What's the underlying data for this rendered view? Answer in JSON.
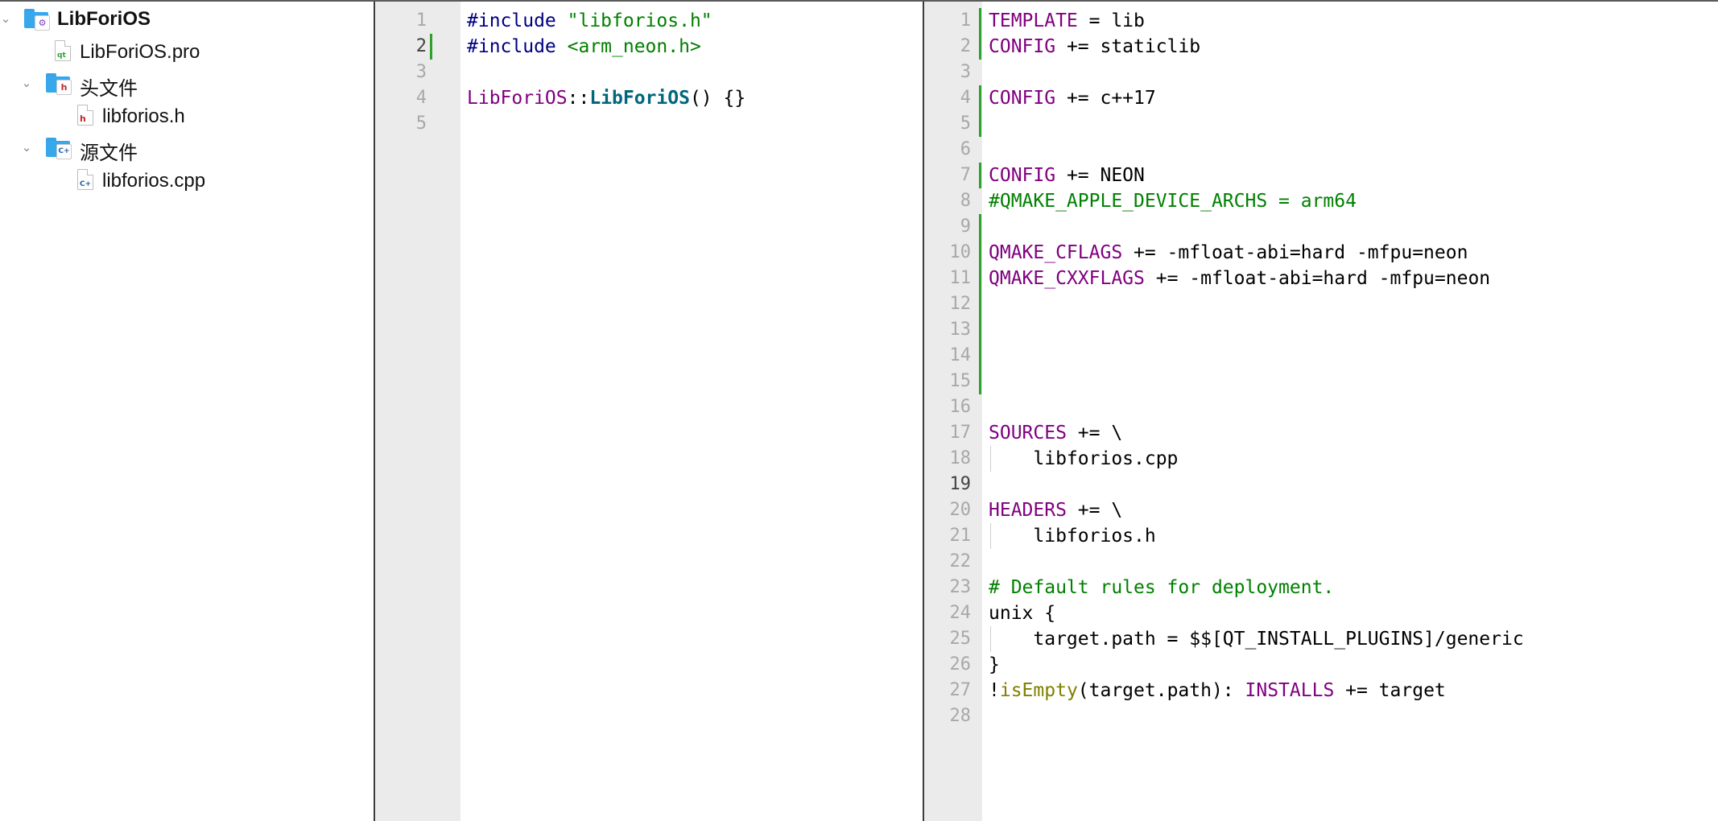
{
  "project_tree": {
    "root": {
      "label": "LibForiOS",
      "expanded": true
    },
    "items": [
      {
        "label": "LibForiOS.pro",
        "kind": "pro-file",
        "icon": "qt-pro-file-icon"
      },
      {
        "label": "头文件",
        "kind": "folder",
        "expanded": true,
        "icon": "header-folder-icon"
      },
      {
        "label": "libforios.h",
        "kind": "file",
        "icon": "header-file-icon"
      },
      {
        "label": "源文件",
        "kind": "folder",
        "expanded": true,
        "icon": "source-folder-icon"
      },
      {
        "label": "libforios.cpp",
        "kind": "file",
        "icon": "cpp-file-icon"
      }
    ]
  },
  "editor_left": {
    "current_line": 2,
    "lines": [
      [
        {
          "t": "#include ",
          "c": "pp"
        },
        {
          "t": "\"libforios.h\"",
          "c": "str"
        }
      ],
      [
        {
          "t": "#include ",
          "c": "pp"
        },
        {
          "t": "<arm_neon.h>",
          "c": "str"
        }
      ],
      [],
      [
        {
          "t": "LibForiOS",
          "c": "ns"
        },
        {
          "t": "::",
          "c": "pl"
        },
        {
          "t": "LibForiOS",
          "c": "fn"
        },
        {
          "t": "() {}",
          "c": "pl"
        }
      ],
      []
    ]
  },
  "editor_right": {
    "current_line": 19,
    "lines": [
      [
        {
          "t": "TEMPLATE",
          "c": "kw"
        },
        {
          "t": " = lib",
          "c": "pl"
        }
      ],
      [
        {
          "t": "CONFIG",
          "c": "kw"
        },
        {
          "t": " += staticlib",
          "c": "pl"
        }
      ],
      [],
      [
        {
          "t": "CONFIG",
          "c": "kw"
        },
        {
          "t": " += c++17",
          "c": "pl"
        }
      ],
      [],
      [],
      [
        {
          "t": "CONFIG",
          "c": "kw"
        },
        {
          "t": " += NEON",
          "c": "pl"
        }
      ],
      [
        {
          "t": "#QMAKE_APPLE_DEVICE_ARCHS = arm64",
          "c": "cm"
        }
      ],
      [],
      [
        {
          "t": "QMAKE_CFLAGS",
          "c": "kw"
        },
        {
          "t": " += -mfloat-abi=hard -mfpu=neon",
          "c": "pl"
        }
      ],
      [
        {
          "t": "QMAKE_CXXFLAGS",
          "c": "kw"
        },
        {
          "t": " += -mfloat-abi=hard -mfpu=neon",
          "c": "pl"
        }
      ],
      [],
      [],
      [],
      [],
      [],
      [
        {
          "t": "SOURCES",
          "c": "kw"
        },
        {
          "t": " += \\",
          "c": "pl"
        }
      ],
      [
        {
          "t": "    libforios.cpp",
          "c": "pl"
        }
      ],
      [],
      [
        {
          "t": "HEADERS",
          "c": "kw"
        },
        {
          "t": " += \\",
          "c": "pl"
        }
      ],
      [
        {
          "t": "    libforios.h",
          "c": "pl"
        }
      ],
      [],
      [
        {
          "t": "# Default rules for deployment.",
          "c": "cm"
        }
      ],
      [
        {
          "t": "unix {",
          "c": "pl"
        }
      ],
      [
        {
          "t": "    target.path = $$[QT_INSTALL_PLUGINS]/generic",
          "c": "pl"
        }
      ],
      [
        {
          "t": "}",
          "c": "pl"
        }
      ],
      [
        {
          "t": "!",
          "c": "pl"
        },
        {
          "t": "isEmpty",
          "c": "bi"
        },
        {
          "t": "(target.path): ",
          "c": "pl"
        },
        {
          "t": "INSTALLS",
          "c": "kw"
        },
        {
          "t": " += target",
          "c": "pl"
        }
      ],
      []
    ]
  },
  "colors": {
    "keyword": "#800080",
    "preprocessor": "#000080",
    "string": "#008000",
    "comment": "#008000",
    "function": "#00677c",
    "builtin": "#808000",
    "change_marker": "#2ea02e",
    "gutter": "#ebebeb"
  }
}
